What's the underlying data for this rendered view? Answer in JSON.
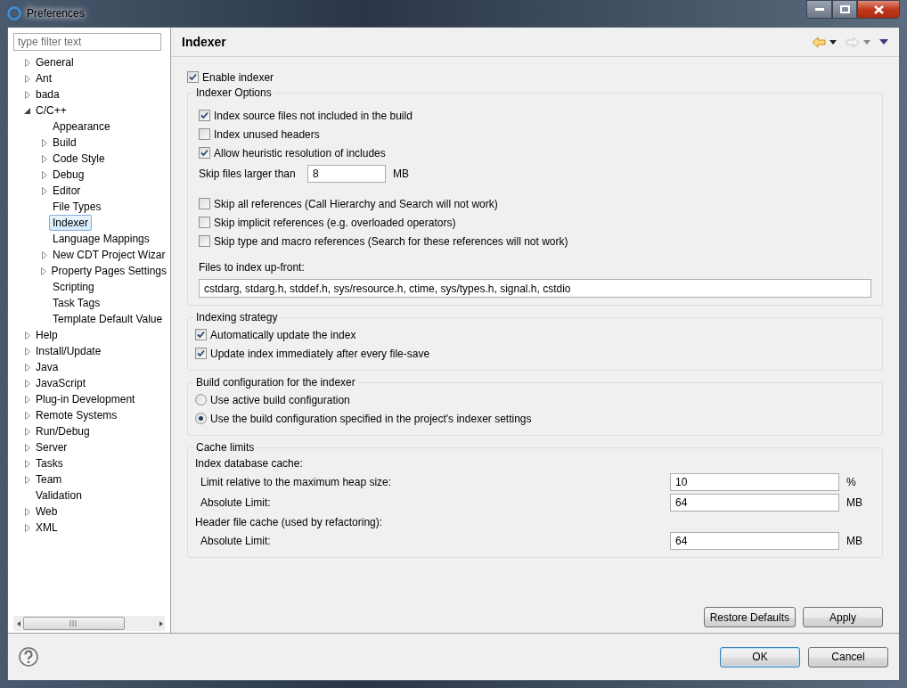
{
  "window": {
    "title": "Preferences"
  },
  "filter": {
    "placeholder": "type filter text"
  },
  "tree": [
    {
      "label": "General",
      "kind": "collapsed",
      "selected": false
    },
    {
      "label": "Ant",
      "kind": "collapsed",
      "selected": false
    },
    {
      "label": "bada",
      "kind": "collapsed",
      "selected": false
    },
    {
      "label": "C/C++",
      "kind": "expanded",
      "selected": false,
      "children": [
        {
          "label": "Appearance",
          "kind": "leaf",
          "selected": false
        },
        {
          "label": "Build",
          "kind": "collapsed",
          "selected": false
        },
        {
          "label": "Code Style",
          "kind": "collapsed",
          "selected": false
        },
        {
          "label": "Debug",
          "kind": "collapsed",
          "selected": false
        },
        {
          "label": "Editor",
          "kind": "collapsed",
          "selected": false
        },
        {
          "label": "File Types",
          "kind": "leaf",
          "selected": false
        },
        {
          "label": "Indexer",
          "kind": "leaf",
          "selected": true
        },
        {
          "label": "Language Mappings",
          "kind": "leaf",
          "selected": false
        },
        {
          "label": "New CDT Project Wizar",
          "kind": "collapsed",
          "selected": false
        },
        {
          "label": "Property Pages Settings",
          "kind": "collapsed",
          "selected": false
        },
        {
          "label": "Scripting",
          "kind": "leaf",
          "selected": false
        },
        {
          "label": "Task Tags",
          "kind": "leaf",
          "selected": false
        },
        {
          "label": "Template Default Value",
          "kind": "leaf",
          "selected": false
        }
      ]
    },
    {
      "label": "Help",
      "kind": "collapsed",
      "selected": false
    },
    {
      "label": "Install/Update",
      "kind": "collapsed",
      "selected": false
    },
    {
      "label": "Java",
      "kind": "collapsed",
      "selected": false
    },
    {
      "label": "JavaScript",
      "kind": "collapsed",
      "selected": false
    },
    {
      "label": "Plug-in Development",
      "kind": "collapsed",
      "selected": false
    },
    {
      "label": "Remote Systems",
      "kind": "collapsed",
      "selected": false
    },
    {
      "label": "Run/Debug",
      "kind": "collapsed",
      "selected": false
    },
    {
      "label": "Server",
      "kind": "collapsed",
      "selected": false
    },
    {
      "label": "Tasks",
      "kind": "collapsed",
      "selected": false
    },
    {
      "label": "Team",
      "kind": "collapsed",
      "selected": false
    },
    {
      "label": "Validation",
      "kind": "leaf",
      "selected": false
    },
    {
      "label": "Web",
      "kind": "collapsed",
      "selected": false
    },
    {
      "label": "XML",
      "kind": "collapsed",
      "selected": false
    }
  ],
  "page": {
    "title": "Indexer"
  },
  "enable_indexer": {
    "label": "Enable indexer",
    "checked": true
  },
  "indexer_options": {
    "title": "Indexer Options",
    "options_top": [
      {
        "label": "Index source files not included in the build",
        "checked": true
      },
      {
        "label": "Index unused headers",
        "checked": false
      },
      {
        "label": "Allow heuristic resolution of includes",
        "checked": true
      }
    ],
    "skip_size": {
      "label": "Skip files larger than",
      "value": "8",
      "unit": "MB"
    },
    "options_skip": [
      {
        "label": "Skip all references (Call Hierarchy and Search will not work)",
        "checked": false
      },
      {
        "label": "Skip implicit references (e.g. overloaded operators)",
        "checked": false
      },
      {
        "label": "Skip type and macro references (Search for these references will not work)",
        "checked": false
      }
    ],
    "files_label": "Files to index up-front:",
    "files_value": "cstdarg, stdarg.h, stddef.h, sys/resource.h, ctime, sys/types.h, signal.h, cstdio"
  },
  "indexing_strategy": {
    "title": "Indexing strategy",
    "options": [
      {
        "label": "Automatically update the index",
        "checked": true
      },
      {
        "label": "Update index immediately after every file-save",
        "checked": true
      }
    ]
  },
  "build_configuration": {
    "title": "Build configuration for the indexer",
    "options": [
      {
        "label": "Use active build configuration",
        "selected": false
      },
      {
        "label": "Use the build configuration specified in the project's indexer settings",
        "selected": true
      }
    ]
  },
  "cache_limits": {
    "title": "Cache limits",
    "sections": [
      {
        "heading": "Index database cache:",
        "rows": [
          {
            "label": "Limit relative to the maximum heap size:",
            "value": "10",
            "unit": "%"
          },
          {
            "label": "Absolute Limit:",
            "value": "64",
            "unit": "MB"
          }
        ]
      },
      {
        "heading": "Header file cache (used by refactoring):",
        "rows": [
          {
            "label": "Absolute Limit:",
            "value": "64",
            "unit": "MB"
          }
        ]
      }
    ]
  },
  "page_buttons": [
    "Restore Defaults",
    "Apply"
  ],
  "dialog_buttons": [
    {
      "label": "OK",
      "default": true
    },
    {
      "label": "Cancel",
      "default": false
    }
  ]
}
